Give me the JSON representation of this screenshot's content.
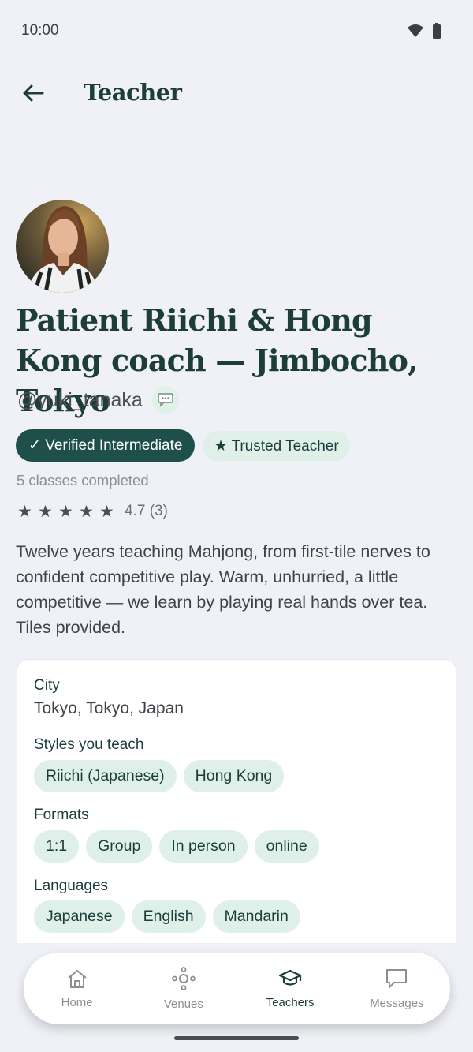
{
  "status_bar": {
    "time": "10:00"
  },
  "app_bar": {
    "title": "Teacher"
  },
  "profile": {
    "name": "Patient Riichi & Hong Kong coach — Jimbocho, Tokyo",
    "handle": "@yuki_tanaka",
    "badges": {
      "verified": "✓ Verified Intermediate",
      "trusted": "★ Trusted Teacher"
    },
    "classes_completed": "5 classes completed",
    "rating": {
      "stars": 5,
      "value_text": "4.7 (3)"
    },
    "bio": "Twelve years teaching Mahjong, from first-tile nerves to confident competitive play. Warm, unhurried, a little competitive — we learn by playing real hands over tea. Tiles provided."
  },
  "details": {
    "city_label": "City",
    "city_value": "Tokyo, Tokyo, Japan",
    "styles_label": "Styles you teach",
    "styles": [
      "Riichi (Japanese)",
      "Hong Kong"
    ],
    "formats_label": "Formats",
    "formats": [
      "1:1",
      "Group",
      "In person",
      "online"
    ],
    "languages_label": "Languages",
    "languages": [
      "Japanese",
      "English",
      "Mandarin"
    ]
  },
  "bottom_nav": {
    "items": [
      {
        "label": "Home",
        "icon": "home-icon"
      },
      {
        "label": "Venues",
        "icon": "venues-icon"
      },
      {
        "label": "Teachers",
        "icon": "graduation-cap-icon",
        "active": true
      },
      {
        "label": "Messages",
        "icon": "message-icon"
      }
    ]
  },
  "colors": {
    "background": "#eff1f6",
    "primary": "#1e4f4b",
    "chip": "#def0e8",
    "heading": "#1d3d3a"
  }
}
